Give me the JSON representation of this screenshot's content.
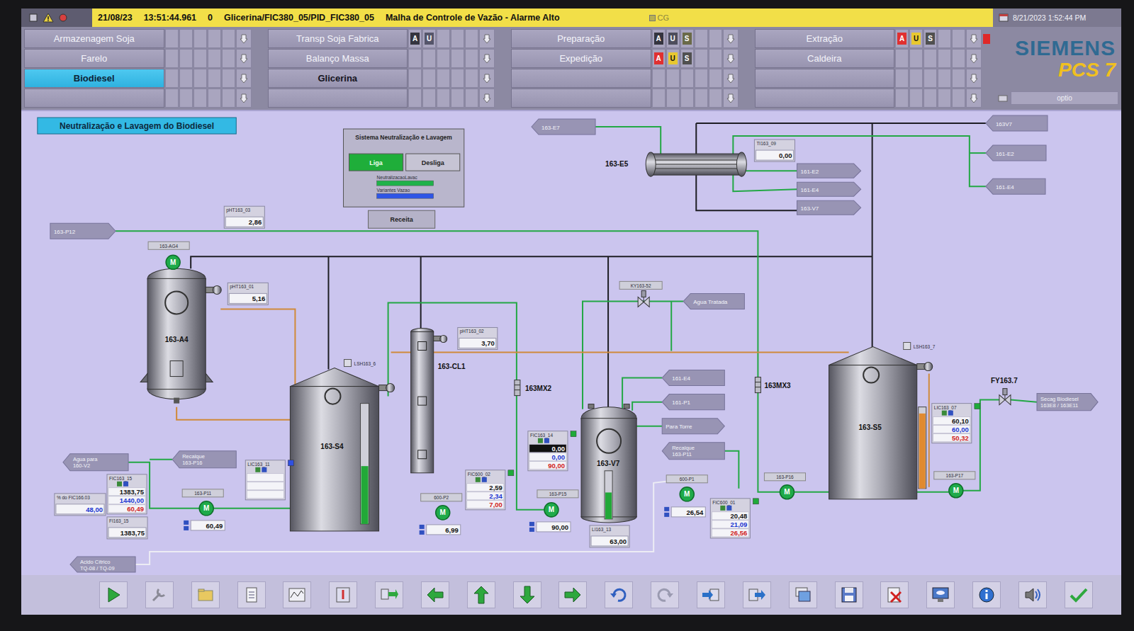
{
  "alarm_bar": {
    "date": "21/08/23",
    "time": "13:51:44.961",
    "count": "0",
    "source": "Glicerina/FIC380_05/PID_FIC380_05",
    "message": "Malha de Controle de Vazão - Alarme Alto",
    "server": "CG",
    "clock": "8/21/2023 1:52:44 PM"
  },
  "area_nav": [
    [
      {
        "label": "Armazenagem Soja",
        "selected": false,
        "emphasized": false,
        "flag": false,
        "badges": []
      },
      {
        "label": "Farelo",
        "selected": false,
        "emphasized": false,
        "flag": false,
        "badges": []
      },
      {
        "label": "Biodiesel",
        "selected": true,
        "emphasized": true,
        "flag": false,
        "badges": []
      },
      {
        "label": "",
        "selected": false,
        "emphasized": false,
        "flag": false,
        "badges": []
      }
    ],
    [
      {
        "label": "Transp Soja Fabrica",
        "selected": false,
        "emphasized": false,
        "flag": false,
        "badges": [
          {
            "text": "A",
            "color": "#34343f"
          },
          {
            "text": "U",
            "color": "#55556a"
          }
        ]
      },
      {
        "label": "Balanço Massa",
        "selected": false,
        "emphasized": false,
        "flag": false,
        "badges": []
      },
      {
        "label": "Glicerina",
        "selected": false,
        "emphasized": true,
        "flag": false,
        "badges": []
      },
      {
        "label": "",
        "selected": false,
        "emphasized": false,
        "flag": false,
        "badges": []
      }
    ],
    [
      {
        "label": "Preparação",
        "selected": false,
        "emphasized": false,
        "flag": false,
        "badges": [
          {
            "text": "A",
            "color": "#34343f"
          },
          {
            "text": "U",
            "color": "#4d4d5c"
          },
          {
            "text": "S",
            "color": "#6a6a48"
          }
        ]
      },
      {
        "label": "Expedição",
        "selected": false,
        "emphasized": false,
        "flag": false,
        "badges": [
          {
            "text": "A",
            "color": "#e03030"
          },
          {
            "text": "U",
            "color": "#e8c830"
          },
          {
            "text": "S",
            "color": "#505050"
          }
        ]
      },
      {
        "label": "",
        "selected": false,
        "emphasized": false,
        "flag": false,
        "badges": []
      },
      {
        "label": "",
        "selected": false,
        "emphasized": false,
        "flag": false,
        "badges": []
      }
    ],
    [
      {
        "label": "Extração",
        "selected": false,
        "emphasized": false,
        "flag": true,
        "badges": [
          {
            "text": "A",
            "color": "#e03030"
          },
          {
            "text": "U",
            "color": "#e8c830"
          },
          {
            "text": "S",
            "color": "#505050"
          }
        ]
      },
      {
        "label": "Caldeira",
        "selected": false,
        "emphasized": false,
        "flag": false,
        "badges": []
      },
      {
        "label": "",
        "selected": false,
        "emphasized": false,
        "flag": false,
        "badges": []
      },
      {
        "label": "",
        "selected": false,
        "emphasized": false,
        "flag": false,
        "badges": []
      }
    ]
  ],
  "logo": {
    "brand": "SIEMENS",
    "product": "PCS 7",
    "field": "optio"
  },
  "diagram": {
    "title": "Neutralização e Lavagem do Biodiesel",
    "control_panel": {
      "title": "Sistema Neutralização e Lavagem",
      "buttons": [
        {
          "label": "Liga",
          "selected": true
        },
        {
          "label": "Desliga",
          "selected": false
        }
      ],
      "status": [
        {
          "label": "NeutralizacaoLavac",
          "color": "#1fb24a"
        },
        {
          "label": "Variantes Vazao",
          "color": "#2e55e6"
        }
      ],
      "recipe": "Receita"
    },
    "vessels": [
      {
        "tag": "163-A4",
        "kind": "reactor"
      },
      {
        "tag": "163-S4",
        "kind": "tank",
        "level": 0.48,
        "color": "#22a838"
      },
      {
        "tag": "163-CL1",
        "kind": "column"
      },
      {
        "tag": "163-V7",
        "kind": "vessel",
        "level": 0.55,
        "color": "#22a838"
      },
      {
        "tag": "163-S5",
        "kind": "tank",
        "level": 0.92,
        "color": "#e08a30"
      }
    ],
    "heat_exchangers": [
      {
        "tag": "163-E5"
      }
    ],
    "mixers": [
      {
        "tag": "163MX2"
      },
      {
        "tag": "163MX3"
      }
    ],
    "valves": [
      {
        "tag": "KY163-52"
      },
      {
        "tag": "FY163.7"
      }
    ],
    "motors": [
      {
        "tag": "163-AG4",
        "symbol": "M",
        "running": true
      },
      {
        "tag": "163-P11",
        "symbol": "M",
        "running": true,
        "speed": "60,49"
      },
      {
        "tag": "600-P2",
        "symbol": "M",
        "running": true,
        "speed": "6,99"
      },
      {
        "tag": "163-P15",
        "symbol": "M",
        "running": true,
        "speed": "90,00"
      },
      {
        "tag": "600-P1",
        "symbol": "M",
        "running": true,
        "speed": "26,54"
      },
      {
        "tag": "163-P16",
        "symbol": "M",
        "running": true
      },
      {
        "tag": "163-P17",
        "symbol": "M",
        "running": true
      }
    ],
    "measurements": [
      {
        "tag": "pHT163_03",
        "value": "2,86",
        "color": "#111111"
      },
      {
        "tag": "pHT163_01",
        "value": "5,16",
        "color": "#111111"
      },
      {
        "tag": "pHT163_02",
        "value": "3,70",
        "color": "#111111"
      },
      {
        "tag": "TI163_09",
        "value": "0,00",
        "color": "#111111"
      },
      {
        "tag": "LI163_13",
        "value": "63,00",
        "color": "#111111"
      },
      {
        "tag": "FI163_15",
        "value": "1383,75",
        "color": "#111111"
      },
      {
        "tag": "% do FIC166.03",
        "value": "48,00",
        "color": "#1a35d0"
      }
    ],
    "controllers": [
      {
        "tag": "FIC163_15",
        "pv": "1383,75",
        "sp": "1440,00",
        "out": "60,49",
        "pv_inverted": false,
        "color": null
      },
      {
        "tag": "FIC600_02",
        "pv": "2,59",
        "sp": "2,34",
        "out": "7,00",
        "pv_inverted": false,
        "color": "#1faa3a"
      },
      {
        "tag": "FIC163_14",
        "pv": "0,00",
        "sp": "0,00",
        "out": "90,00",
        "pv_inverted": true,
        "color": "#1faa3a"
      },
      {
        "tag": "FIC600_01",
        "pv": "20,48",
        "sp": "21,09",
        "out": "26,56",
        "pv_inverted": false,
        "color": "#1faa3a"
      },
      {
        "tag": "LIC163_07",
        "pv": "60,10",
        "sp": "60,00",
        "out": "50,32",
        "pv_inverted": false,
        "color": "#1faa3a"
      },
      {
        "tag": "LIC163_11",
        "pv": "",
        "sp": "",
        "out": "",
        "pv_inverted": false,
        "color": "#3050e0"
      }
    ],
    "level_switches": [
      {
        "tag": "LSH163_6"
      },
      {
        "tag": "LSH163_7"
      }
    ],
    "connectors": [
      {
        "lines": [
          "163-P12"
        ],
        "direction": "right"
      },
      {
        "lines": [
          "163-E7"
        ],
        "direction": "left"
      },
      {
        "lines": [
          "161-E2"
        ],
        "direction": "right"
      },
      {
        "lines": [
          "161-E4"
        ],
        "direction": "right"
      },
      {
        "lines": [
          "163-V7"
        ],
        "direction": "right"
      },
      {
        "lines": [
          "163V7"
        ],
        "direction": "left"
      },
      {
        "lines": [
          "161-E2"
        ],
        "direction": "left"
      },
      {
        "lines": [
          "161-E4"
        ],
        "direction": "left"
      },
      {
        "lines": [
          "Agua Tratada"
        ],
        "direction": "left"
      },
      {
        "lines": [
          "161-E4"
        ],
        "direction": "left"
      },
      {
        "lines": [
          "161-P1"
        ],
        "direction": "left"
      },
      {
        "lines": [
          "Para Torre"
        ],
        "direction": "right"
      },
      {
        "lines": [
          "Recalque",
          "163-P11"
        ],
        "direction": "left"
      },
      {
        "lines": [
          "Agua para",
          "160-V2"
        ],
        "direction": "left"
      },
      {
        "lines": [
          "Recalque",
          "163-P16"
        ],
        "direction": "left"
      },
      {
        "lines": [
          "Secag Biodiesel",
          "163E8 / 163E11"
        ],
        "direction": "right"
      },
      {
        "lines": [
          "Acido Cítrico",
          "TQ-08 / TQ-09"
        ],
        "direction": "left"
      }
    ]
  }
}
